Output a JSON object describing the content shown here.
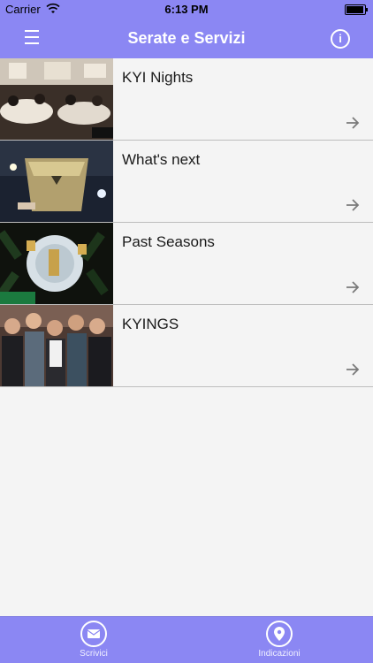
{
  "status_bar": {
    "carrier": "Carrier",
    "time": "6:13 PM",
    "battery_level": 1.0
  },
  "navbar": {
    "title": "Serate e Servizi",
    "menu_icon": "hamburger-menu-icon",
    "info_icon": "info-icon",
    "info_glyph": "i"
  },
  "list": {
    "items": [
      {
        "label": "KYI Nights",
        "image": "restaurant-event-photo",
        "arrow": "arrow-right-icon"
      },
      {
        "label": "What's next",
        "image": "champagne-bucket-photo",
        "arrow": "arrow-right-icon"
      },
      {
        "label": "Past Seasons",
        "image": "champagne-bottles-photo",
        "arrow": "arrow-right-icon"
      },
      {
        "label": "KYINGS",
        "image": "group-people-photo",
        "arrow": "arrow-right-icon"
      }
    ]
  },
  "tabbar": {
    "tabs": [
      {
        "label": "Scrivici",
        "icon": "envelope-icon"
      },
      {
        "label": "Indicazioni",
        "icon": "map-pin-icon"
      }
    ]
  },
  "colors": {
    "accent": "#8b87f3",
    "background": "#f4f4f4",
    "separator": "#bdbdbd"
  }
}
